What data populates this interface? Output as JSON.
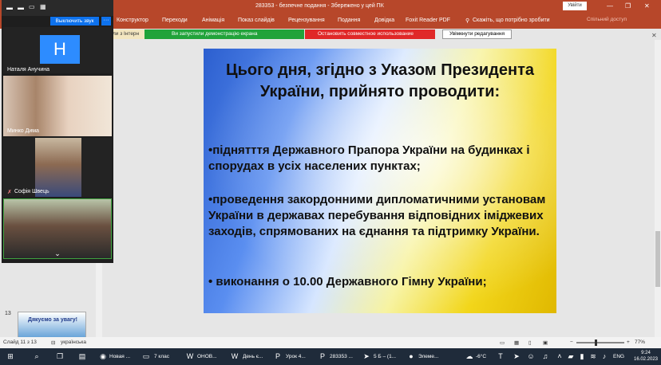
{
  "window": {
    "title": "283353  -  безпечне подання  -  Збережено у цей ПК",
    "signin_label": "Увійти",
    "minimize": "—",
    "maximize": "❐",
    "close": "✕"
  },
  "ribbon": {
    "tabs": [
      "Конструктор",
      "Переходи",
      "Анімація",
      "Показ слайдів",
      "Рецензування",
      "Подання",
      "Довідка",
      "Foxit Reader PDF",
      "Скажіть, що потрібно зробити"
    ],
    "share_label": "Спільний доступ"
  },
  "notices": {
    "partial_left": "ли з Інтерн",
    "screen_share": "Ви запустили демонстрацію екрана",
    "stop_share": "Остановить совместное использование",
    "enable_editing": "Увімкнути редагування"
  },
  "slide": {
    "title": "Цього дня, згідно з Указом Президента України, прийнято проводити:",
    "bullets": [
      "•піднятття Державного Прапора України на будинках і спорудах в усіх населених пунктах;",
      "•проведення закордонними дипломатичними установам України в державах перебування відповідних іміджевих заходів, спрямованих на єднання та підтримку України.",
      "• виконання о 10.00 Державного Гімну України;"
    ]
  },
  "thumbnails": {
    "number": "13",
    "caption": "Дякуємо за увагу!"
  },
  "statusbar": {
    "slide_info": "Слайд 11 з 13",
    "language": "українська",
    "zoom_minus": "−",
    "zoom_plus": "+",
    "zoom": "77%"
  },
  "zoom_panel": {
    "mute_label": "Выключить звук",
    "more_label": "···",
    "participants": [
      {
        "name": "Наталя Анучина",
        "initial": "H"
      },
      {
        "name": "Минко Дима"
      },
      {
        "name": "Софія Швець"
      },
      {
        "name": ""
      }
    ]
  },
  "taskbar": {
    "apps": [
      "Новая ...",
      "7 клас",
      "ОНОВ...",
      "День є...",
      "Урок 4...",
      "283353 ...",
      "5 Б – (1...",
      "Элеме..."
    ],
    "weather": "-6°C",
    "language": "ENG",
    "time": "9:24",
    "date": "16.02.2023"
  },
  "colors": {
    "accent": "#b7472a",
    "zoom_blue": "#0e72ed",
    "notice_green": "#21a33a",
    "notice_red": "#e02828"
  }
}
